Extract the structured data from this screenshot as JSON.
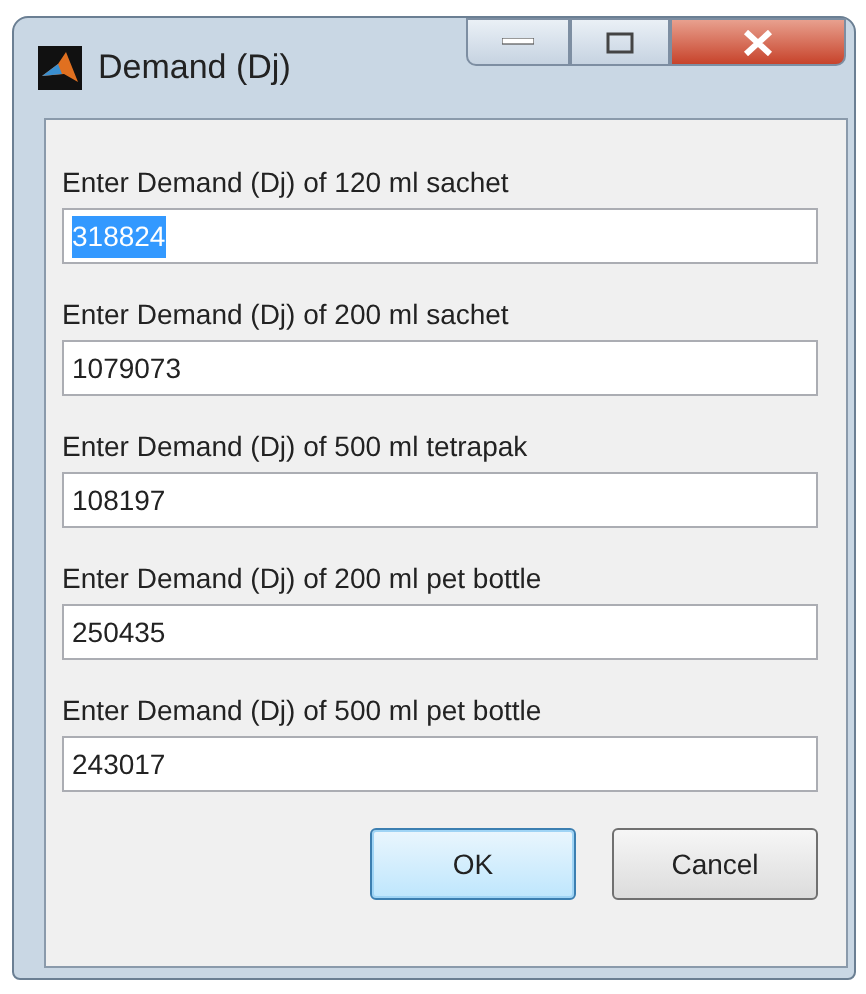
{
  "window": {
    "title": "Demand (Dj)"
  },
  "fields": [
    {
      "label": "Enter Demand (Dj) of 120 ml sachet",
      "value": "318824",
      "text_selected": true
    },
    {
      "label": "Enter Demand (Dj) of 200 ml sachet",
      "value": "1079073",
      "text_selected": false
    },
    {
      "label": "Enter Demand (Dj) of 500 ml tetrapak",
      "value": "108197",
      "text_selected": false
    },
    {
      "label": "Enter Demand (Dj) of 200 ml pet bottle",
      "value": "250435",
      "text_selected": false
    },
    {
      "label": "Enter Demand (Dj) of 500 ml pet bottle",
      "value": "243017",
      "text_selected": false
    }
  ],
  "buttons": [
    {
      "label": "OK",
      "default": true
    },
    {
      "label": "Cancel",
      "default": false
    }
  ]
}
